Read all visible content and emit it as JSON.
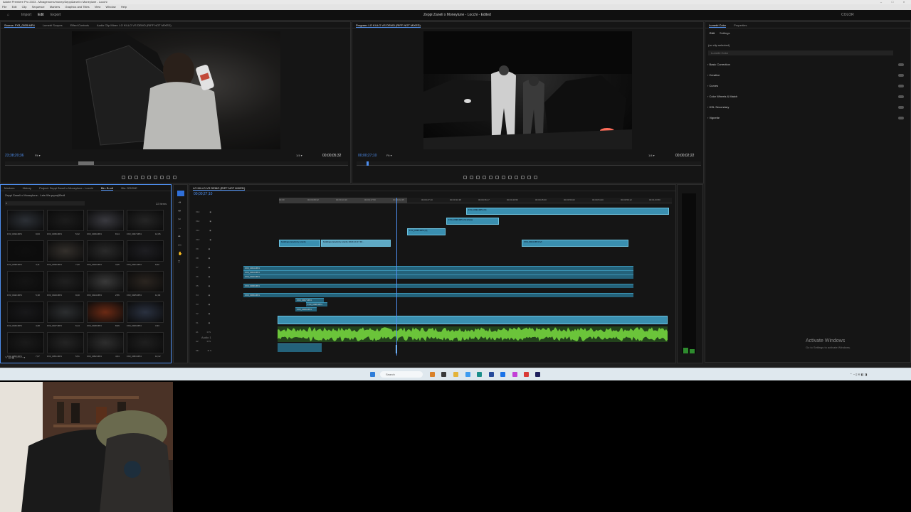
{
  "app": {
    "title": "Adobe Premiere Pro 2023 - Mixagenomx/money/ZeppiZaneli x Moneylune - Locchi",
    "center_title": "Zeppi Zaneli x Moneylune - Locchi - Edited",
    "menu": [
      "File",
      "Edit",
      "Clip",
      "Sequence",
      "Markers",
      "Graphics and Titles",
      "View",
      "Window",
      "Help"
    ],
    "workspace_tabs": [
      "Import",
      "Edit",
      "Export"
    ],
    "workspace_right": [
      "COLOR"
    ]
  },
  "source_monitor": {
    "tabs": [
      "Source: FX3_0035.MP4",
      "Lumetri Scopes",
      "Effect Controls",
      "Audio Clip Mixer: LO KILLO VS DEMO (RIFF NOT MIXED)"
    ],
    "timecode": "23;38;20;36",
    "fit": "Fit",
    "ratio": "1/4",
    "duration": "00;00;05;32"
  },
  "program_monitor": {
    "tabs": [
      "Program: LO KILLO VS DEMO (RIFF NOT MIXED)"
    ],
    "timecode": "00;00;27;10",
    "fit": "Fit",
    "ratio": "1/4",
    "duration": "00;00;02;22"
  },
  "project_panel": {
    "tabs": [
      "Markers",
      "History",
      "Project: Zeppi Zaneli x Moneylune - Locchi",
      "Bin: B-roll",
      "Bin: DRONE"
    ],
    "path": "Zeppi Zaneli x Moneylune - Lets Ws.prproj\\Broll",
    "count": "22 items",
    "items": [
      {
        "name": "FX3_0034.MP4",
        "dur": "9;03"
      },
      {
        "name": "FX3_0035.MP4",
        "dur": "5;32"
      },
      {
        "name": "FX3_0036.MP4",
        "dur": "8;14"
      },
      {
        "name": "FX3_0037.MP4",
        "dur": "12;05"
      },
      {
        "name": "FX3_0038.MP4",
        "dur": "4;11"
      },
      {
        "name": "FX3_0039.MP4",
        "dur": "7;20"
      },
      {
        "name": "FX3_0040.MP4",
        "dur": "3;45"
      },
      {
        "name": "FX3_0041.MP4",
        "dur": "6;02"
      },
      {
        "name": "FX3_0042.MP4",
        "dur": "5;18"
      },
      {
        "name": "FX3_0043.MP4",
        "dur": "9;40"
      },
      {
        "name": "FX3_0044.MP4",
        "dur": "2;56"
      },
      {
        "name": "FX3_0045.MP4",
        "dur": "11;03"
      },
      {
        "name": "FX3_0046.MP4",
        "dur": "4;28"
      },
      {
        "name": "FX3_0047.MP4",
        "dur": "6;14"
      },
      {
        "name": "FX3_0048.MP4",
        "dur": "8;09"
      },
      {
        "name": "FX3_0049.MP4",
        "dur": "3;33"
      },
      {
        "name": "FX3_0050.MP4",
        "dur": "7;07"
      },
      {
        "name": "FX3_0051.MP4",
        "dur": "5;51"
      },
      {
        "name": "FX3_0052.MP4",
        "dur": "4;04"
      },
      {
        "name": "FX3_0053.MP4",
        "dur": "10;12"
      }
    ]
  },
  "timeline": {
    "tab": "LO KILLO VS DEMO (RIFF NOT MIXED)",
    "timecode": "00;00;27;10",
    "ruler_ticks": [
      "00;00",
      "00;00;08;32",
      "00;00;13;10",
      "00;00;17;50",
      "00;00;22;25",
      "00;00;27;10",
      "00;00;31;38",
      "00;00;36;17",
      "00;00;40;50",
      "00;00;45;30",
      "00;00;50;02",
      "00;00;54;40",
      "00;00;59;12",
      "00;01;03;50"
    ],
    "video_tracks": [
      "V13",
      "V12",
      "V11",
      "V10",
      "V9",
      "V8",
      "V7",
      "V6",
      "V5",
      "V4",
      "V3",
      "V2",
      "V1"
    ],
    "audio_tracks": [
      "A1",
      "A2",
      "Mix"
    ],
    "video_clips": [
      {
        "label": "FX3_0034.MP4 [V]"
      },
      {
        "label": "FX3_0036.MP4 [V] [V(A)]"
      },
      {
        "label": "FX3_0035.MP4 [V]"
      },
      {
        "label": "buildings (stock) by sturdo"
      },
      {
        "label": "buildings (stock) by sturdo 2023-10-17 16..."
      },
      {
        "label": "FX3_0044.MP4 [V]"
      }
    ],
    "mid_clips": [
      "FX3_0034.MP4",
      "FX3_0034.MP4",
      "FX3_0040.MP4",
      "FX3_0038.MP4",
      "FX3_0036.MP4",
      "FX3_0037.MP4",
      "FX3_0038.MP4",
      "FX3_0039.MP4"
    ],
    "audio_label": "Audio 1"
  },
  "lumetri": {
    "tabs": [
      "Lumetri Color",
      "Properties"
    ],
    "subtabs": [
      "Edit",
      "Settings"
    ],
    "no_clip": "(no clip selected)",
    "lumetri_color": "Lumetri Color",
    "sections": [
      "Basic Correction",
      "Creative",
      "Curves",
      "Color Wheels & Match",
      "HSL Secondary",
      "Vignette"
    ]
  },
  "watermark": {
    "title": "Activate Windows",
    "sub": "Go to Settings to activate Windows."
  },
  "taskbar": {
    "search": "Search"
  },
  "colors": {
    "accent": "#4e8ff0",
    "clip_video": "#3a8fb0",
    "clip_audio_bg": "#24627a",
    "waveform": "#6bc43a",
    "playhead": "#4e8ff0"
  }
}
